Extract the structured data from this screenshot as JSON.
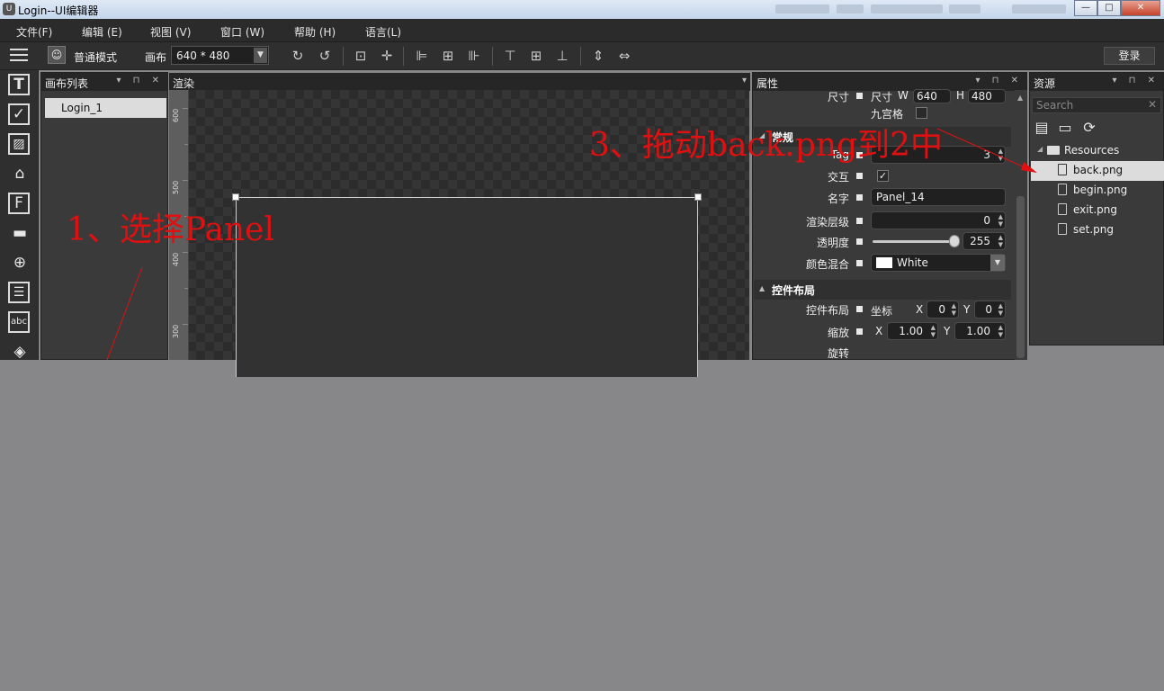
{
  "window": {
    "title": "Login--UI编辑器",
    "minimize": "—",
    "maximize": "□",
    "close": "✕"
  },
  "menu": [
    "文件(F)",
    "编辑 (E)",
    "视图 (V)",
    "窗口 (W)",
    "帮助 (H)",
    "语言(L)"
  ],
  "toolbar": {
    "mode_label": "普通模式",
    "canvas_label": "画布",
    "canvas_size": "640 * 480",
    "login_label": "登录"
  },
  "tools": [
    {
      "name": "text-tool-icon",
      "glyph": "T"
    },
    {
      "name": "checkbox-tool-icon",
      "glyph": "✓"
    },
    {
      "name": "image-tool-icon",
      "glyph": "▨"
    },
    {
      "name": "tag-tool-icon",
      "glyph": "⌂"
    },
    {
      "name": "font-tool-icon",
      "glyph": "F"
    },
    {
      "name": "progress-tool-icon",
      "glyph": "▬"
    },
    {
      "name": "slider-tool-icon",
      "glyph": "⊕"
    },
    {
      "name": "list-tool-icon",
      "glyph": "☰"
    },
    {
      "name": "textfield-tool-icon",
      "glyph": "abc"
    },
    {
      "name": "layers-tool-icon",
      "glyph": "◈"
    }
  ],
  "canvas_list": {
    "title": "画布列表",
    "items": [
      "Login_1"
    ]
  },
  "render": {
    "title": "渲染",
    "ruler_ticks": [
      "600",
      "500",
      "400",
      "300"
    ]
  },
  "properties": {
    "title": "属性",
    "size_label": "尺寸",
    "size_sub": "尺寸",
    "w_label": "W",
    "w_value": "640",
    "h_label": "H",
    "h_value": "480",
    "nine_grid_label": "九宫格",
    "common_section": "常规",
    "tag_label": "Tag",
    "tag_value": "3",
    "interact_label": "交互",
    "interact_checked": "✓",
    "name_label": "名字",
    "name_value": "Panel_14",
    "render_layer_label": "渲染层级",
    "render_layer_value": "0",
    "opacity_label": "透明度",
    "opacity_value": "255",
    "opacity_fraction": 1.0,
    "color_blend_label": "颜色混合",
    "color_blend_value": "White",
    "layout_section": "控件布局",
    "layout_label": "控件布局",
    "coord_label": "坐标",
    "x_label": "X",
    "x_value": "0",
    "y_label": "Y",
    "y_value": "0",
    "scale_label": "缩放",
    "scale_x": "1.00",
    "scale_y": "1.00",
    "rotate_label": "旋转"
  },
  "resources": {
    "title": "资源",
    "search_placeholder": "Search",
    "root": "Resources",
    "files": [
      "back.png",
      "begin.png",
      "exit.png",
      "set.png"
    ],
    "selected": "back.png"
  },
  "annotations": {
    "step1": "1、选择Panel",
    "step3": "3、拖动back.png到2中",
    "color": "#e01010"
  }
}
